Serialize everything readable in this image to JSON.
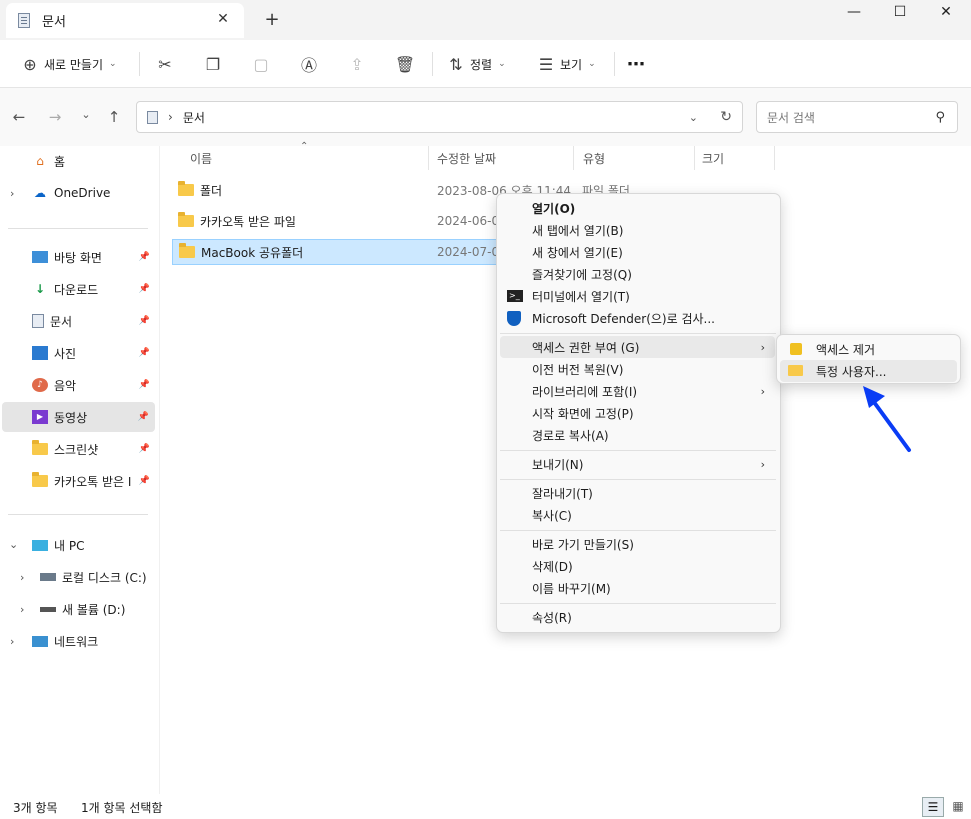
{
  "window": {
    "tab_title": "문서",
    "close_tab": "✕",
    "new_tab": "+",
    "minimize": "—",
    "maximize": "☐",
    "close": "✕"
  },
  "toolbar": {
    "new_label": "새로 만들기",
    "sort_label": "정렬",
    "view_label": "보기",
    "more": "⋯"
  },
  "address": {
    "path": "문서",
    "search_placeholder": "문서 검색"
  },
  "sidebar": {
    "home": "홈",
    "onedrive": "OneDrive",
    "pinned": [
      "바탕 화면",
      "다운로드",
      "문서",
      "사진",
      "음악",
      "동영상",
      "스크린샷",
      "카카오톡 받은 I"
    ],
    "pc": "내 PC",
    "drives": [
      "로컬 디스크 (C:)",
      "새 볼륨 (D:)"
    ],
    "network": "네트워크"
  },
  "columns": {
    "name": "이름",
    "modified": "수정한 날짜",
    "type": "유형",
    "size": "크기"
  },
  "files": [
    {
      "name": "폴더",
      "date": "2023-08-06 오후 11:44",
      "type": "파일 폴더"
    },
    {
      "name": "카카오톡 받은 파일",
      "date": "2024-06-0"
    },
    {
      "name": "MacBook 공유폴더",
      "date": "2024-07-0"
    }
  ],
  "context_menu": {
    "open": "열기(O)",
    "open_new_tab": "새 탭에서 열기(B)",
    "open_new_window": "새 창에서 열기(E)",
    "pin_favorites": "즐겨찾기에 고정(Q)",
    "open_terminal": "터미널에서 열기(T)",
    "defender": "Microsoft Defender(으)로 검사...",
    "give_access": "액세스 권한 부여 (G)",
    "restore_prev": "이전 버전 복원(V)",
    "include_library": "라이브러리에 포함(I)",
    "pin_start": "시작 화면에 고정(P)",
    "copy_path": "경로로 복사(A)",
    "send_to": "보내기(N)",
    "cut": "잘라내기(T)",
    "copy": "복사(C)",
    "create_shortcut": "바로 가기 만들기(S)",
    "delete": "삭제(D)",
    "rename": "이름 바꾸기(M)",
    "properties": "속성(R)"
  },
  "submenu": {
    "remove_access": "액세스 제거",
    "specific_people": "특정 사용자..."
  },
  "status": {
    "item_count": "3개 항목",
    "selected": "1개 항목 선택함"
  },
  "colors": {
    "accent": "#0078d4",
    "selection": "#cce8ff",
    "arrow": "#0a3cf5"
  }
}
